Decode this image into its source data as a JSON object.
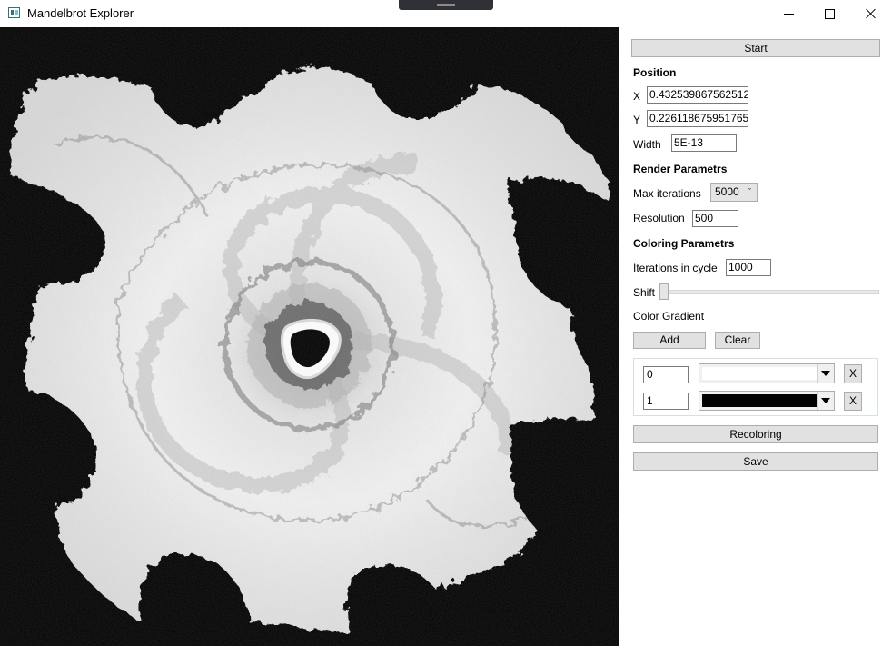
{
  "window": {
    "title": "Mandelbrot Explorer"
  },
  "fractal": {
    "center_x": "0.432539867562512",
    "center_y": "0.226118675951765",
    "width": "5E-13"
  },
  "panel": {
    "start_label": "Start",
    "position_header": "Position",
    "x_label": "X",
    "x_value": "0.432539867562512",
    "y_label": "Y",
    "y_value": "0.226118675951765",
    "width_label": "Width",
    "width_value": "5E-13",
    "render_header": "Render Parametrs",
    "max_iter_label": "Max iterations",
    "max_iter_value": "5000",
    "resolution_label": "Resolution",
    "resolution_value": "500",
    "coloring_header": "Coloring Parametrs",
    "cycle_label": "Iterations in cycle",
    "cycle_value": "1000",
    "shift_label": "Shift",
    "shift_value": 0,
    "gradient_label": "Color Gradient",
    "add_label": "Add",
    "clear_label": "Clear",
    "gradient_stops": [
      {
        "offset": "0",
        "color": "#ffffff",
        "remove_label": "X"
      },
      {
        "offset": "1",
        "color": "#000000",
        "remove_label": "X"
      }
    ],
    "recolor_label": "Recoloring",
    "save_label": "Save"
  },
  "icons": {
    "app": "app-icon",
    "minimize": "minimize-icon",
    "maximize": "maximize-icon",
    "close": "close-icon",
    "dropdown": "chevron-down-icon"
  }
}
